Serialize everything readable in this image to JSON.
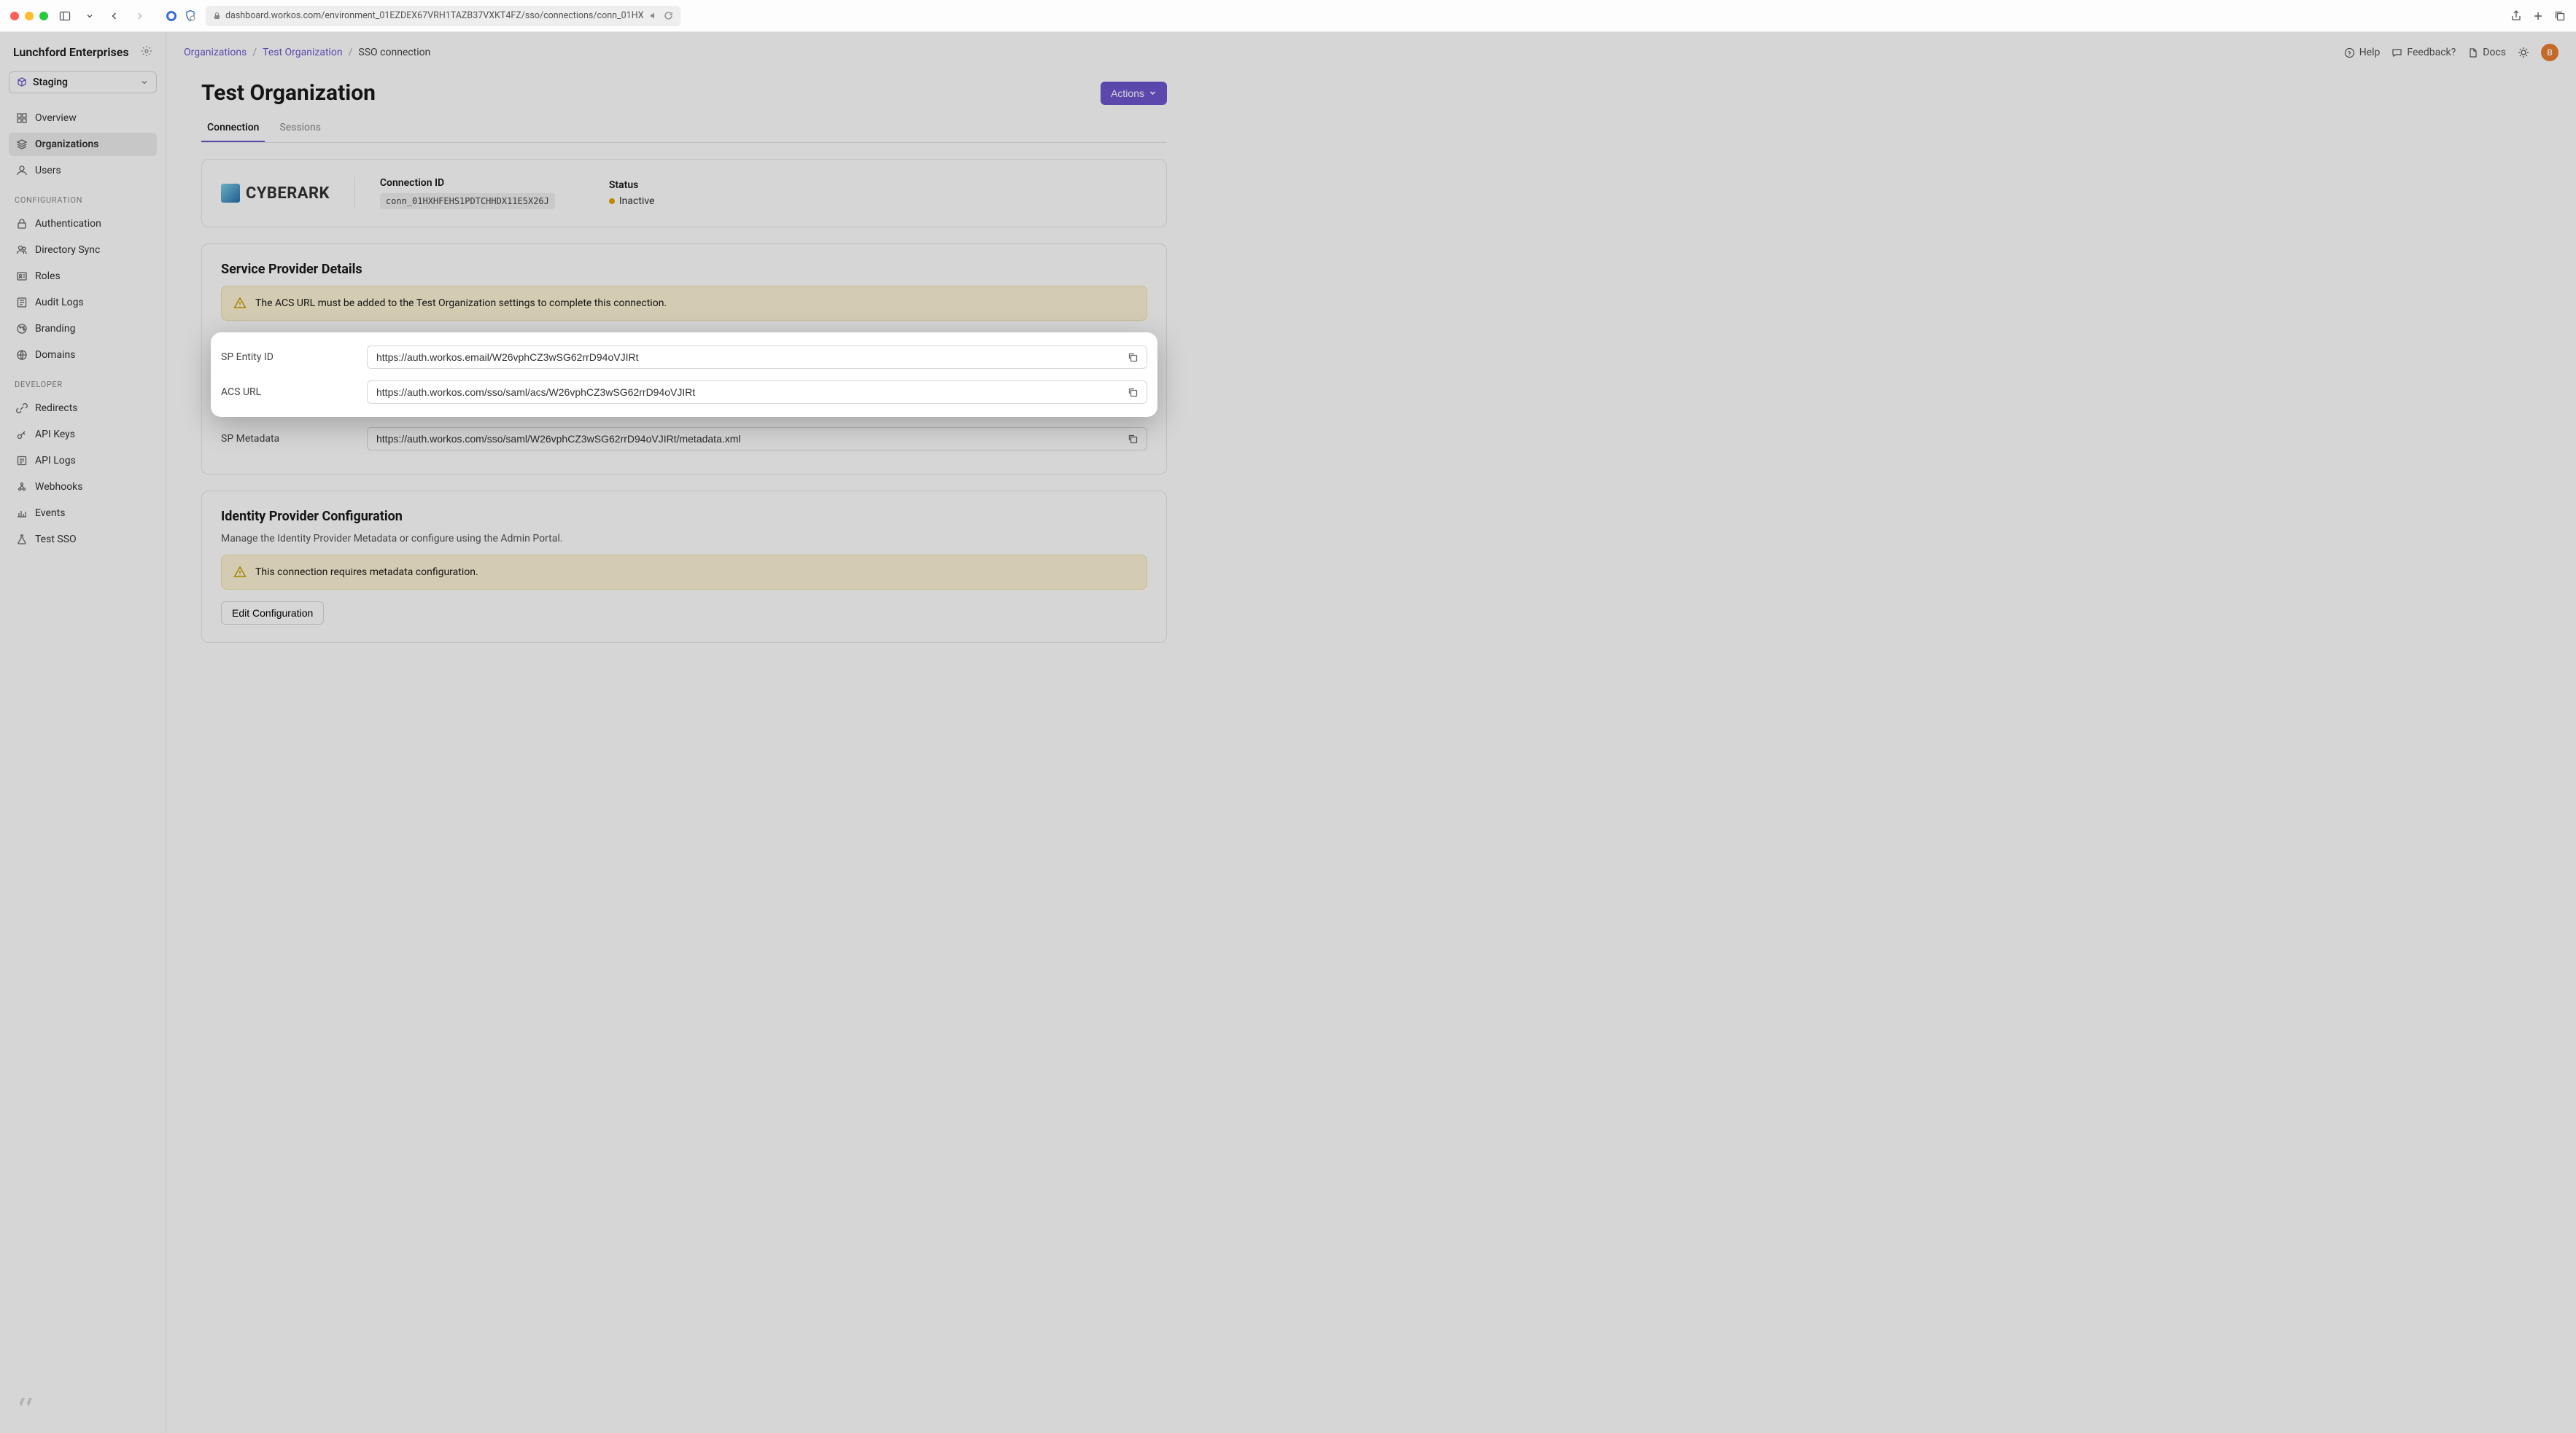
{
  "browser": {
    "url": "dashboard.workos.com/environment_01EZDEX67VRH1TAZB37VXKT4FZ/sso/connections/conn_01HX"
  },
  "company": "Lunchford Enterprises",
  "env": {
    "label": "Staging"
  },
  "nav": {
    "main": [
      {
        "label": "Overview"
      },
      {
        "label": "Organizations"
      },
      {
        "label": "Users"
      }
    ],
    "section_config_label": "Configuration",
    "config": [
      {
        "label": "Authentication"
      },
      {
        "label": "Directory Sync"
      },
      {
        "label": "Roles"
      },
      {
        "label": "Audit Logs"
      },
      {
        "label": "Branding"
      },
      {
        "label": "Domains"
      }
    ],
    "section_dev_label": "Developer",
    "dev": [
      {
        "label": "Redirects"
      },
      {
        "label": "API Keys"
      },
      {
        "label": "API Logs"
      },
      {
        "label": "Webhooks"
      },
      {
        "label": "Events"
      },
      {
        "label": "Test SSO"
      }
    ]
  },
  "crumbs": {
    "a": "Organizations",
    "b": "Test Organization",
    "c": "SSO connection"
  },
  "top": {
    "help": "Help",
    "feedback": "Feedback?",
    "docs": "Docs",
    "avatar": "B"
  },
  "page": {
    "title": "Test Organization",
    "actions_btn": "Actions",
    "tabs": {
      "connection": "Connection",
      "sessions": "Sessions"
    }
  },
  "connection": {
    "provider_name": "CYBERARK",
    "id_label": "Connection ID",
    "id_value": "conn_01HXHFEHS1PDTCHHDX11E5X26J",
    "status_label": "Status",
    "status_value": "Inactive"
  },
  "sp": {
    "heading": "Service Provider Details",
    "warning": "The ACS URL must be added to the Test Organization settings to complete this connection.",
    "entity_label": "SP Entity ID",
    "entity_value": "https://auth.workos.email/W26vphCZ3wSG62rrD94oVJIRt",
    "acs_label": "ACS URL",
    "acs_value": "https://auth.workos.com/sso/saml/acs/W26vphCZ3wSG62rrD94oVJIRt",
    "meta_label": "SP Metadata",
    "meta_value": "https://auth.workos.com/sso/saml/W26vphCZ3wSG62rrD94oVJIRt/metadata.xml"
  },
  "idp": {
    "heading": "Identity Provider Configuration",
    "desc": "Manage the Identity Provider Metadata or configure using the Admin Portal.",
    "warning": "This connection requires metadata configuration.",
    "edit_btn": "Edit Configuration"
  }
}
